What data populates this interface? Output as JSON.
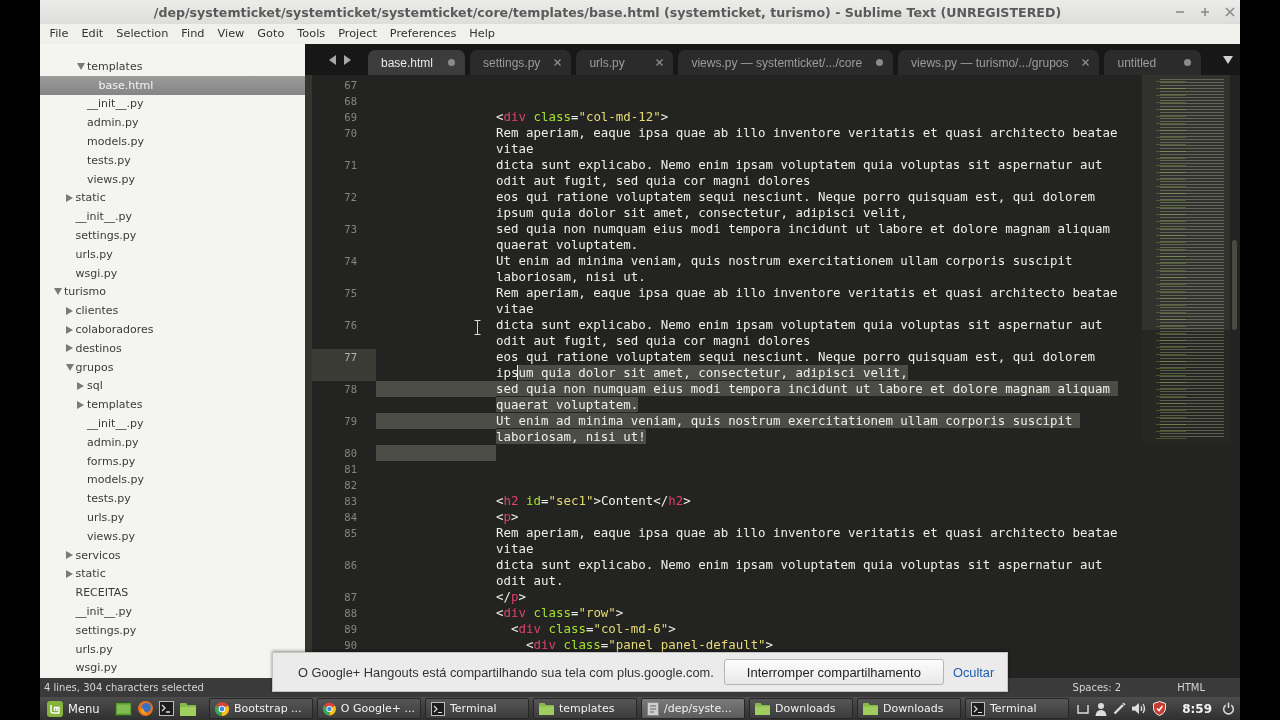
{
  "window": {
    "title": "/dep/systemticket/systemticket/systemticket/core/templates/base.html (systemticket, turismo) - Sublime Text (UNREGISTERED)"
  },
  "menu": [
    "File",
    "Edit",
    "Selection",
    "Find",
    "View",
    "Goto",
    "Tools",
    "Project",
    "Preferences",
    "Help"
  ],
  "sidebar": {
    "tree": [
      {
        "children": [
          {
            "children": [
              {
                "label": "templates",
                "kind": "folder",
                "expanded": true,
                "selected": false,
                "children": [
                  {
                    "label": "base.html",
                    "kind": "file",
                    "selected": true
                  }
                ]
              },
              {
                "label": "__init__.py",
                "kind": "file",
                "selected": false
              },
              {
                "label": "admin.py",
                "kind": "file",
                "selected": false
              },
              {
                "label": "models.py",
                "kind": "file",
                "selected": false
              },
              {
                "label": "tests.py",
                "kind": "file",
                "selected": false
              },
              {
                "label": "views.py",
                "kind": "file",
                "selected": false
              }
            ]
          },
          {
            "label": "static",
            "kind": "folder",
            "expanded": false,
            "selected": false
          },
          {
            "label": "__init__.py",
            "kind": "file",
            "selected": false
          },
          {
            "label": "settings.py",
            "kind": "file",
            "selected": false
          },
          {
            "label": "urls.py",
            "kind": "file",
            "selected": false
          },
          {
            "label": "wsgi.py",
            "kind": "file",
            "selected": false
          }
        ]
      },
      {
        "label": "turismo",
        "kind": "folder",
        "expanded": true,
        "selected": false,
        "children": [
          {
            "label": "clientes",
            "kind": "folder",
            "expanded": false,
            "selected": false
          },
          {
            "label": "colaboradores",
            "kind": "folder",
            "expanded": false,
            "selected": false
          },
          {
            "label": "destinos",
            "kind": "folder",
            "expanded": false,
            "selected": false
          },
          {
            "label": "grupos",
            "kind": "folder",
            "expanded": true,
            "selected": false,
            "children": [
              {
                "label": "sql",
                "kind": "folder",
                "expanded": false,
                "selected": false
              },
              {
                "label": "templates",
                "kind": "folder",
                "expanded": false,
                "selected": false
              },
              {
                "label": "__init__.py",
                "kind": "file",
                "selected": false
              },
              {
                "label": "admin.py",
                "kind": "file",
                "selected": false
              },
              {
                "label": "forms.py",
                "kind": "file",
                "selected": false
              },
              {
                "label": "models.py",
                "kind": "file",
                "selected": false
              },
              {
                "label": "tests.py",
                "kind": "file",
                "selected": false
              },
              {
                "label": "urls.py",
                "kind": "file",
                "selected": false
              },
              {
                "label": "views.py",
                "kind": "file",
                "selected": false
              }
            ]
          },
          {
            "label": "servicos",
            "kind": "folder",
            "expanded": false,
            "selected": false
          },
          {
            "label": "static",
            "kind": "folder",
            "expanded": false,
            "selected": false
          },
          {
            "label": "RECEITAS",
            "kind": "file",
            "selected": false
          },
          {
            "label": "__init__.py",
            "kind": "file",
            "selected": false
          },
          {
            "label": "settings.py",
            "kind": "file",
            "selected": false
          },
          {
            "label": "urls.py",
            "kind": "file",
            "selected": false
          },
          {
            "label": "wsgi.py",
            "kind": "file",
            "selected": false
          }
        ]
      }
    ]
  },
  "tabs": [
    {
      "label": "base.html",
      "selected": true,
      "modified": true
    },
    {
      "label": "settings.py",
      "selected": false,
      "modified": false
    },
    {
      "label": "urls.py",
      "selected": false,
      "modified": false
    },
    {
      "label": "views.py — systemticket/.../core",
      "selected": false,
      "modified": true
    },
    {
      "label": "views.py — turismo/.../grupos",
      "selected": false,
      "modified": false
    },
    {
      "label": "untitled",
      "selected": false,
      "modified": true
    }
  ],
  "editor": {
    "lines": [
      {
        "number": "67",
        "current": false,
        "selected": false
      },
      {
        "number": "68",
        "current": false,
        "selected": false
      },
      {
        "number": "69",
        "current": false,
        "selected": false,
        "tokens": [
          {
            "kind": "text",
            "text": "<"
          },
          {
            "kind": "tag",
            "text": "div"
          },
          {
            "kind": "attr",
            "text": " class"
          },
          {
            "kind": "text",
            "text": "="
          },
          {
            "kind": "string",
            "text": "\"col-md-12\""
          },
          {
            "kind": "text",
            "text": ">"
          }
        ]
      },
      {
        "number": "70",
        "current": false,
        "selected": false,
        "text": "Rem aperiam, eaque ipsa quae ab illo inventore veritatis et quasi architecto beatae vitae"
      },
      {
        "number": "71",
        "current": false,
        "selected": false,
        "text": "dicta sunt explicabo. Nemo enim ipsam voluptatem quia voluptas sit aspernatur aut odit aut fugit, sed quia cor magni dolores"
      },
      {
        "number": "72",
        "current": false,
        "selected": false,
        "text": "eos qui ratione voluptatem sequi nesciunt. Neque porro quisquam est, qui dolorem ipsum quia dolor sit amet, consectetur, adipisci velit,"
      },
      {
        "number": "73",
        "current": false,
        "selected": false,
        "text": "sed quia non numquam eius modi tempora incidunt ut labore et dolore magnam aliquam quaerat voluptatem."
      },
      {
        "number": "74",
        "current": false,
        "selected": false,
        "text": "Ut enim ad minima veniam, quis nostrum exercitationem ullam corporis suscipit laboriosam, nisi ut."
      },
      {
        "number": "75",
        "current": false,
        "selected": false,
        "text": "Rem aperiam, eaque ipsa quae ab illo inventore veritatis et quasi architecto beatae vitae"
      },
      {
        "number": "76",
        "current": false,
        "selected": false,
        "text": "dicta sunt explicabo. Nemo enim ipsam voluptatem quia voluptas sit aspernatur aut odit aut fugit, sed quia cor magni dolores"
      },
      {
        "number": "77",
        "current": true,
        "selected": false,
        "text": "eos qui ratione voluptatem sequi nesciunt. Neque porro quisquam est, qui dolorem ips",
        "selected_text": "um quia dolor sit amet, consectetur, adipisci velit,"
      },
      {
        "number": "78",
        "current": false,
        "selected": true,
        "selected_text": "sed quia non numquam eius modi tempora incidunt ut labore et dolore magnam aliquam quaerat voluptatem."
      },
      {
        "number": "79",
        "current": false,
        "selected": true,
        "selected_text": "Ut enim ad minima veniam, quis nostrum exercitationem ullam corporis suscipit laboriosam, nisi ut!"
      },
      {
        "number": "80",
        "current": false,
        "selected": true
      },
      {
        "number": "81",
        "current": false,
        "selected": false
      },
      {
        "number": "82",
        "current": false,
        "selected": false
      },
      {
        "number": "83",
        "current": false,
        "selected": false,
        "tokens": [
          {
            "kind": "text",
            "text": "<"
          },
          {
            "kind": "tag",
            "text": "h2"
          },
          {
            "kind": "attr",
            "text": " id"
          },
          {
            "kind": "text",
            "text": "="
          },
          {
            "kind": "string",
            "text": "\"sec1\""
          },
          {
            "kind": "text",
            "text": ">Content</"
          },
          {
            "kind": "tag",
            "text": "h2"
          },
          {
            "kind": "text",
            "text": ">"
          }
        ]
      },
      {
        "number": "84",
        "current": false,
        "selected": false,
        "tokens": [
          {
            "kind": "text",
            "text": "<"
          },
          {
            "kind": "tag",
            "text": "p"
          },
          {
            "kind": "text",
            "text": ">"
          }
        ]
      },
      {
        "number": "85",
        "current": false,
        "selected": false,
        "text": "Rem aperiam, eaque ipsa quae ab illo inventore veritatis et quasi architecto beatae vitae"
      },
      {
        "number": "86",
        "current": false,
        "selected": false,
        "text": "dicta sunt explicabo. Nemo enim ipsam voluptatem quia voluptas sit aspernatur aut odit aut."
      },
      {
        "number": "87",
        "current": false,
        "selected": false,
        "tokens": [
          {
            "kind": "text",
            "text": "</"
          },
          {
            "kind": "tag",
            "text": "p"
          },
          {
            "kind": "text",
            "text": ">"
          }
        ]
      },
      {
        "number": "88",
        "current": false,
        "selected": false,
        "tokens": [
          {
            "kind": "text",
            "text": "<"
          },
          {
            "kind": "tag",
            "text": "div"
          },
          {
            "kind": "attr",
            "text": " class"
          },
          {
            "kind": "text",
            "text": "="
          },
          {
            "kind": "string",
            "text": "\"row\""
          },
          {
            "kind": "text",
            "text": ">"
          }
        ]
      },
      {
        "number": "89",
        "current": false,
        "selected": false,
        "tokens": [
          {
            "kind": "text",
            "text": "  <"
          },
          {
            "kind": "tag",
            "text": "div"
          },
          {
            "kind": "attr",
            "text": " class"
          },
          {
            "kind": "text",
            "text": "="
          },
          {
            "kind": "string",
            "text": "\"col-md-6\""
          },
          {
            "kind": "text",
            "text": ">"
          }
        ]
      },
      {
        "number": "90",
        "current": false,
        "selected": false,
        "tokens": [
          {
            "kind": "text",
            "text": "    <"
          },
          {
            "kind": "tag",
            "text": "div"
          },
          {
            "kind": "attr",
            "text": " class"
          },
          {
            "kind": "text",
            "text": "="
          },
          {
            "kind": "string",
            "text": "\"panel panel-default\""
          },
          {
            "kind": "text",
            "text": ">"
          }
        ]
      }
    ]
  },
  "status_bar": {
    "selection": "4 lines, 304 characters selected",
    "indentation": "Spaces: 2",
    "syntax": "HTML"
  },
  "share_notice": {
    "message": "O Google+ Hangouts está compartilhando sua tela com plus.google.com.",
    "button": "Interromper compartilhamento",
    "link": "Ocultar"
  },
  "taskbar": {
    "menu": "Menu",
    "windows": [
      {
        "label": "Bootstrap ...",
        "kind": "browser",
        "selected": false
      },
      {
        "label": "O Google+ ...",
        "kind": "browser",
        "selected": false
      },
      {
        "label": "Terminal",
        "kind": "terminal",
        "selected": false
      },
      {
        "label": "templates",
        "kind": "folder",
        "selected": false
      },
      {
        "label": "/dep/syste...",
        "kind": "editor",
        "selected": true
      },
      {
        "label": "Downloads",
        "kind": "folder",
        "selected": false
      },
      {
        "label": "Downloads",
        "kind": "folder",
        "selected": false
      },
      {
        "label": "Terminal",
        "kind": "terminal",
        "selected": false
      }
    ],
    "clock": "8:59"
  }
}
